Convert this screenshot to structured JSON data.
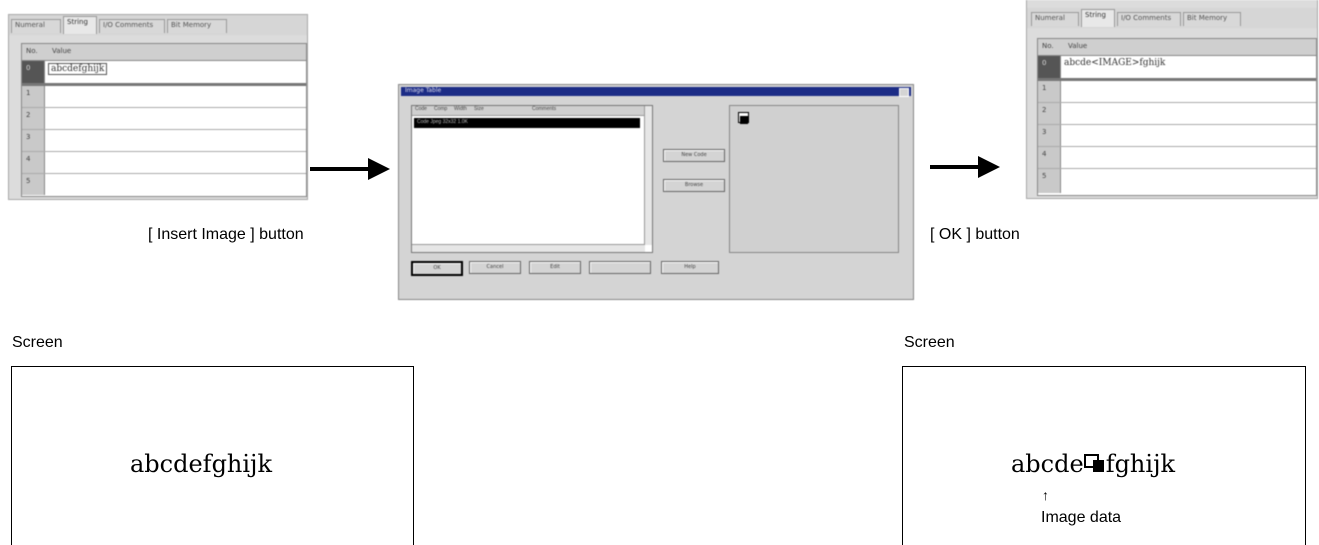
{
  "left_editor": {
    "tabs": [
      "Numeral",
      "String",
      "I/O Comments",
      "Bit Memory"
    ],
    "grid": {
      "headers": [
        "No.",
        "Value"
      ],
      "rows": [
        {
          "no": "0",
          "value": "abcdefghijk"
        },
        {
          "no": "1",
          "value": ""
        },
        {
          "no": "2",
          "value": ""
        },
        {
          "no": "3",
          "value": ""
        },
        {
          "no": "4",
          "value": ""
        },
        {
          "no": "5",
          "value": ""
        }
      ]
    }
  },
  "insert_label": "[ Insert Image ]   button",
  "dialog": {
    "title": "Image Table",
    "list_headers": [
      "Code",
      "Comp",
      "Width",
      "Size",
      "Comments"
    ],
    "list_row": "Code Jpeg 32x32 1.0K",
    "side_buttons": [
      "New Code",
      "Browse"
    ],
    "bottom_buttons": [
      "OK",
      "Cancel",
      "Edit",
      "",
      "Help"
    ]
  },
  "right_editor": {
    "tabs": [
      "Numeral",
      "String",
      "I/O Comments",
      "Bit Memory"
    ],
    "grid": {
      "headers": [
        "No.",
        "Value"
      ],
      "rows": [
        {
          "no": "0",
          "value": "abcde<IMAGE>fghijk"
        },
        {
          "no": "1",
          "value": ""
        },
        {
          "no": "2",
          "value": ""
        },
        {
          "no": "3",
          "value": ""
        },
        {
          "no": "4",
          "value": ""
        },
        {
          "no": "5",
          "value": ""
        }
      ]
    }
  },
  "ok_label": "[ OK ] button",
  "screen_left": {
    "caption": "Screen",
    "text": "abcdefghijk"
  },
  "screen_right": {
    "caption": "Screen",
    "text_before": "abcde",
    "text_after": "fghijk",
    "arrow": "↑",
    "annotation": "Image data"
  }
}
